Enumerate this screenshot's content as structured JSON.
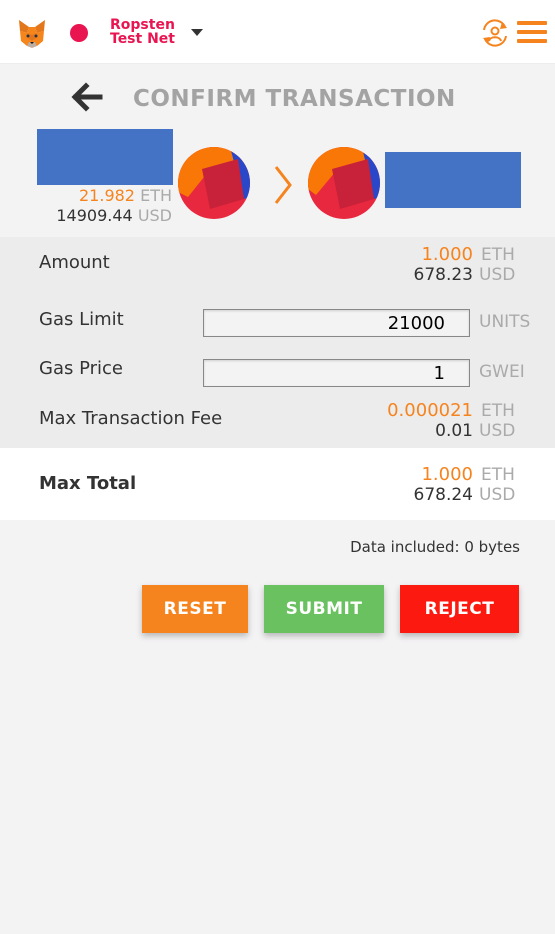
{
  "header": {
    "network_name": "Ropsten Test Net",
    "network_color": "#e91550",
    "accent_color": "#f5841f",
    "icons": [
      "metamask-fox-icon",
      "network-dot-icon",
      "caret-down-icon",
      "account-switch-icon",
      "menu-icon"
    ]
  },
  "title": "CONFIRM TRANSACTION",
  "from": {
    "balance_eth": "21.982",
    "balance_eth_unit": "ETH",
    "balance_usd": "14909.44",
    "balance_usd_unit": "USD"
  },
  "rows": {
    "amount": {
      "label": "Amount",
      "eth": "1.000",
      "eth_unit": "ETH",
      "usd": "678.23",
      "usd_unit": "USD"
    },
    "gas_limit": {
      "label": "Gas Limit",
      "value": "21000",
      "unit": "UNITS"
    },
    "gas_price": {
      "label": "Gas Price",
      "value": "1",
      "unit": "GWEI"
    },
    "max_fee": {
      "label": "Max Transaction Fee",
      "eth": "0.000021",
      "eth_unit": "ETH",
      "usd": "0.01",
      "usd_unit": "USD"
    }
  },
  "total": {
    "label": "Max Total",
    "eth": "1.000",
    "eth_unit": "ETH",
    "usd": "678.24",
    "usd_unit": "USD"
  },
  "data_included": "Data included: 0 bytes",
  "buttons": {
    "reset": "RESET",
    "submit": "SUBMIT",
    "reject": "REJECT"
  }
}
